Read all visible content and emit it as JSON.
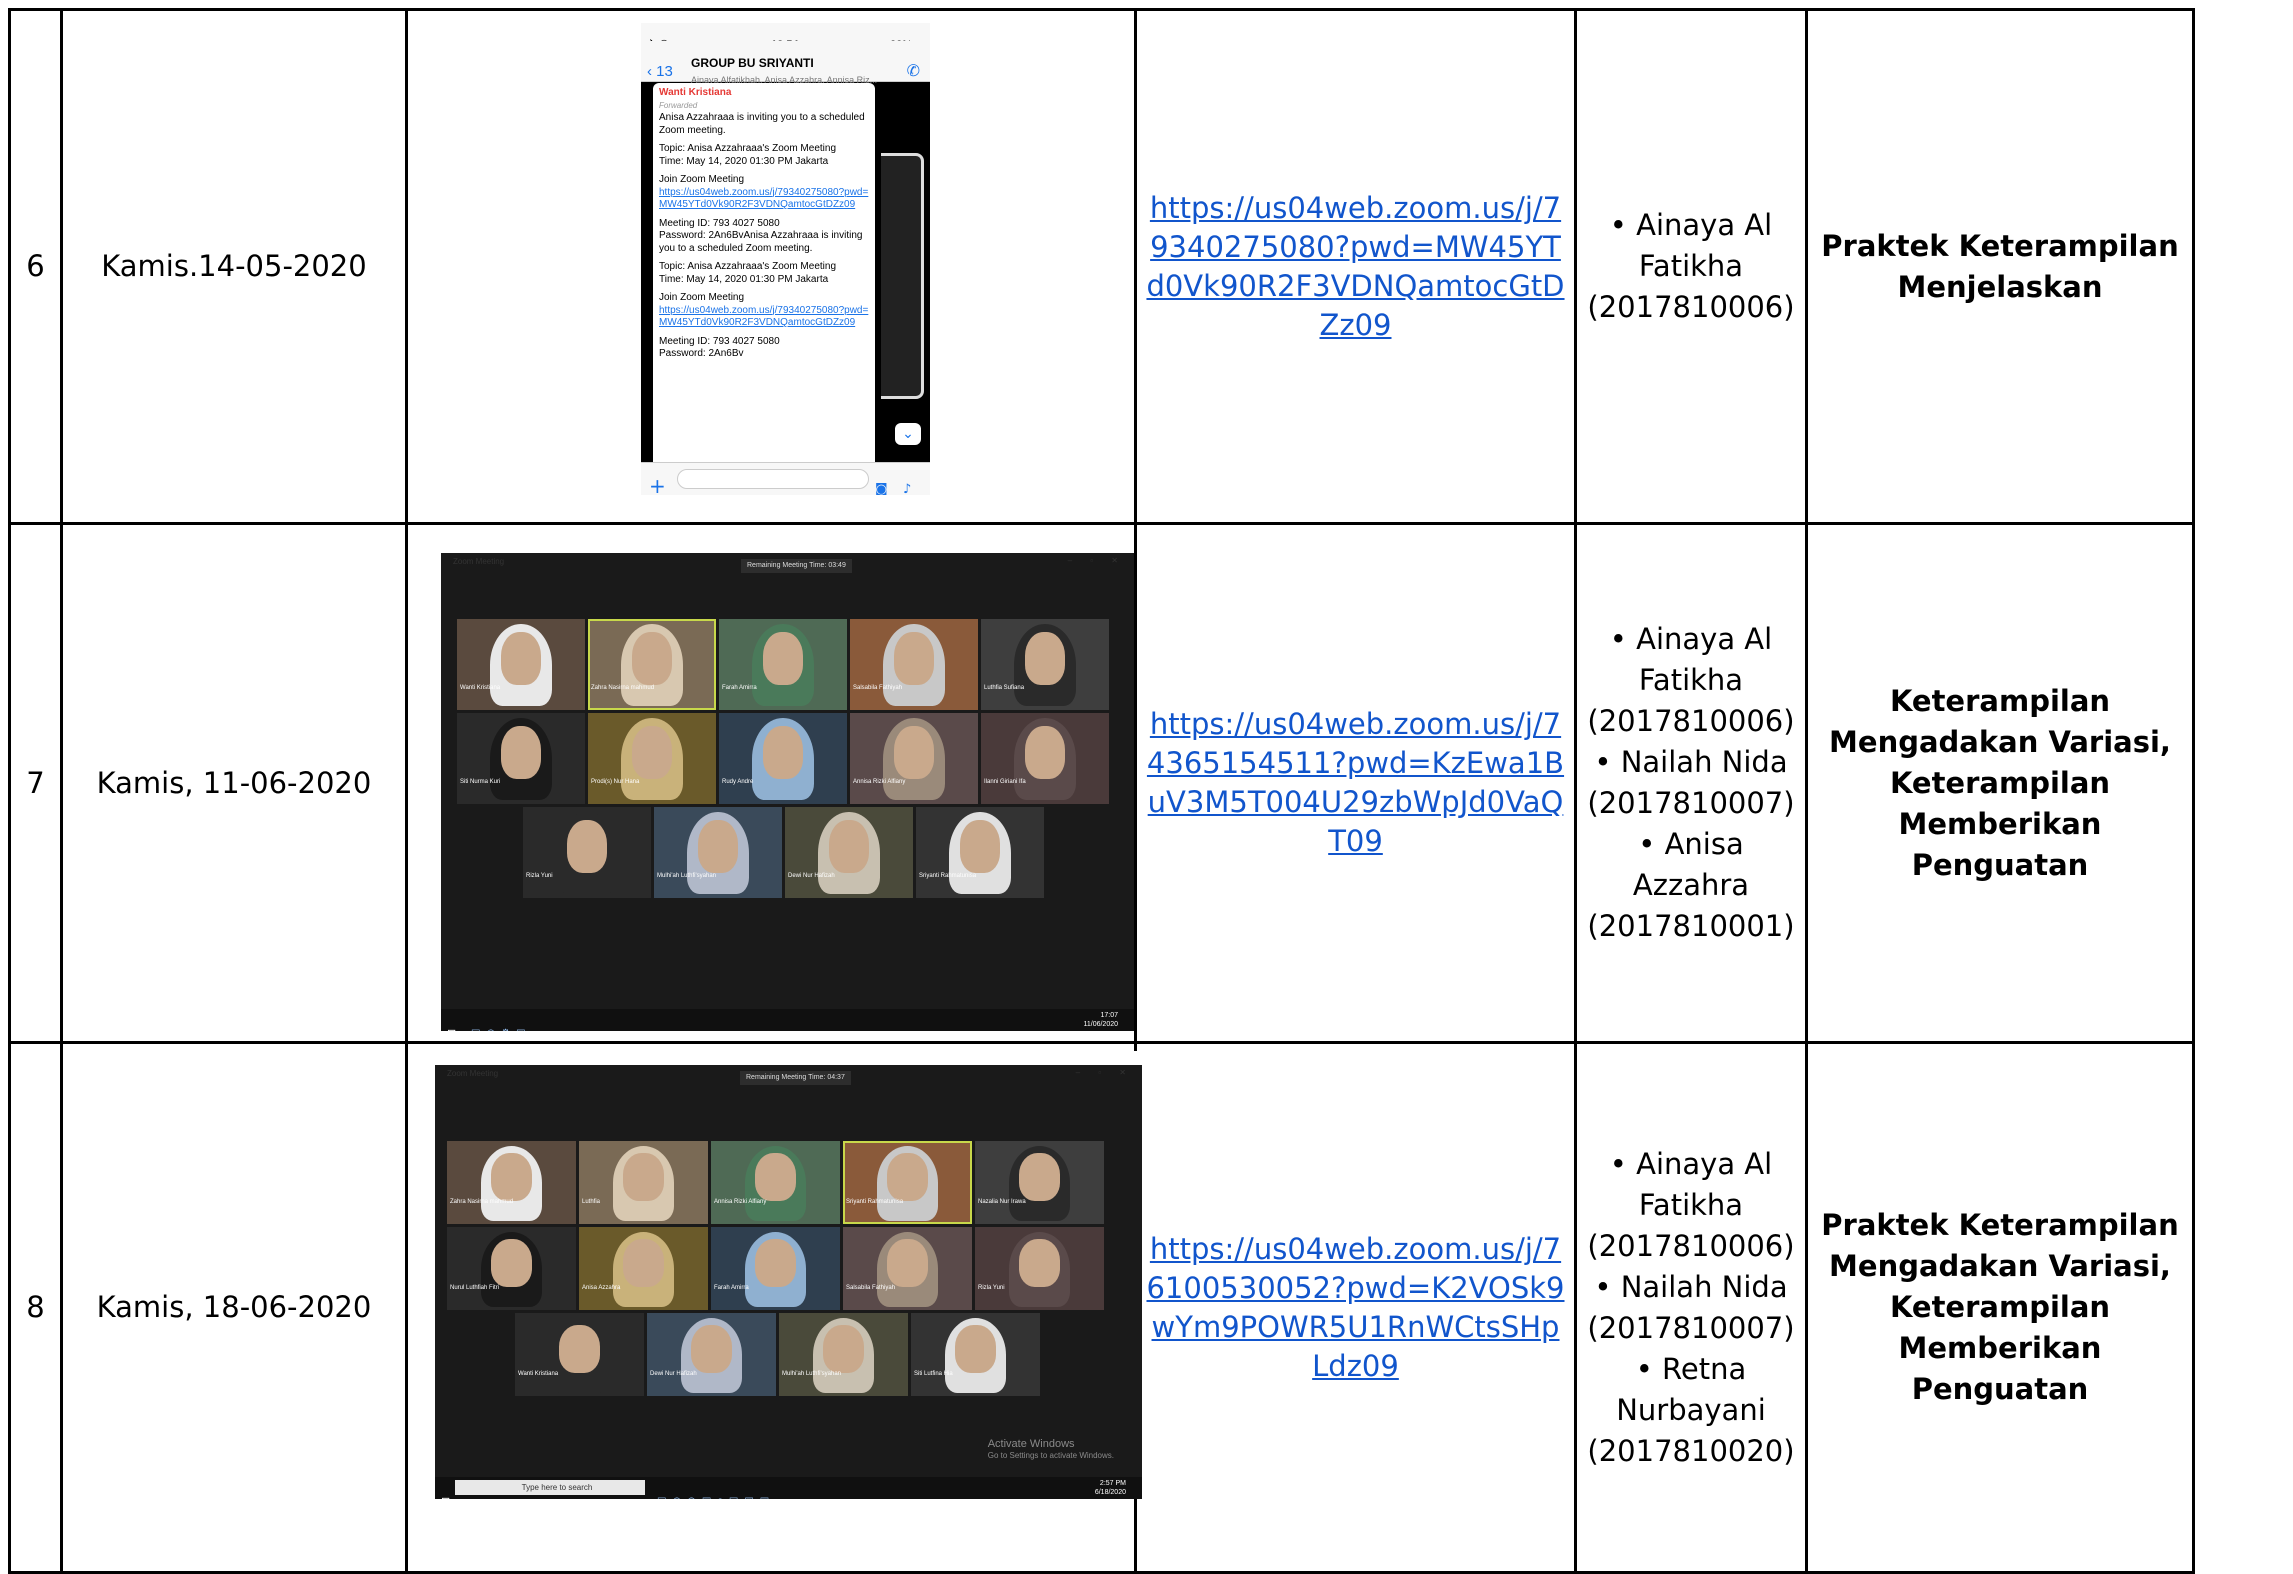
{
  "rows": [
    {
      "no": "6",
      "date": "Kamis.14-05-2020",
      "link": "https://us04web.zoom.us/j/79340275080?pwd=MW45YTd0Vk90R2F3VDNQamtocGtDZz09",
      "names": [
        "• Ainaya Al Fatikha (2017810006)"
      ],
      "topic": "Praktek Keterampilan Menjelaskan"
    },
    {
      "no": "7",
      "date": "Kamis, 11-06-2020",
      "link": "https://us04web.zoom.us/j/74365154511?pwd=KzEwa1BuV3M5T004U29zbWpJd0VaQT09",
      "names": [
        "• Ainaya Al Fatikha (2017810006)",
        "• Nailah Nida (2017810007)",
        "• Anisa Azzahra (2017810001)"
      ],
      "topic": "Keterampilan Mengadakan Variasi, Keterampilan Memberikan Penguatan"
    },
    {
      "no": "8",
      "date": "Kamis, 18-06-2020",
      "link": "https://us04web.zoom.us/j/76100530052?pwd=K2VOSk9wYm9POWR5U1RnWCtsSHpLdz09",
      "names": [
        "• Ainaya Al Fatikha (2017810006)",
        "• Nailah Nida (2017810007)",
        "• Retna Nurbayani (2017810020)"
      ],
      "topic": "Praktek Keterampilan Mengadakan Variasi, Keterampilan Memberikan Penguatan"
    }
  ],
  "phone": {
    "status_time": "12.54",
    "status_battery": "22%",
    "back_label": "13",
    "group_title": "GROUP BU SRIYANTI",
    "group_members": "Ainaya Alfatikhah, Anisa Azzahra, Annisa Riz...",
    "sender": "Wanti Kristiana",
    "forwarded": "Forwarded",
    "paragraphs": [
      "Anisa Azzahraaa is inviting you to a scheduled Zoom meeting.",
      "Topic: Anisa Azzahraaa's Zoom Meeting\nTime: May 14, 2020 01:30 PM Jakarta",
      "Join Zoom Meeting",
      "Meeting ID: 793 4027 5080\nPassword: 2An6BvAnisa Azzahraaa is inviting you to a scheduled Zoom meeting.",
      "Topic: Anisa Azzahraaa's Zoom Meeting\nTime: May 14, 2020 01:30 PM Jakarta",
      "Join Zoom Meeting",
      "Meeting ID: 793 4027 5080\nPassword: 2An6Bv"
    ],
    "chat_link": "https://us04web.zoom.us/j/79340275080?pwd=MW45YTd0Vk90R2F3VDNQamtocGtDZz09"
  },
  "zoom7": {
    "window_title": "Zoom Meeting",
    "timer": "Remaining Meeting Time: 03:49",
    "clock": "17:07\n11/06/2020",
    "participants": [
      "Wanti Kristiana",
      "Zahra Nasirna mahmud",
      "Farah Amirra",
      "Salsabila Fathiyah",
      "Luthfia Sufiana",
      "Siti Nurma Kuri",
      "Prodi(s) Nur Hana",
      "Rudy Andre",
      "Annisa Rizki Alfiany",
      "Ilanni Giriani Ifa",
      "Rizla Yuni",
      "Mulhi'ah Luthfi'syahan",
      "Dewi Nur Hafizah",
      "Sriyanti Rahmatunisa"
    ]
  },
  "zoom8": {
    "window_title": "Zoom Meeting",
    "timer": "Remaining Meeting Time: 04:37",
    "clock": "2:57 PM\n6/18/2020",
    "search_placeholder": "Type here to search",
    "watermark_title": "Activate Windows",
    "watermark_sub": "Go to Settings to activate Windows.",
    "participants": [
      "Zahra Nasirna mahmud",
      "Luthfia",
      "Annisa Rizki Alfiany",
      "Sriyanti Rahmatunisa",
      "Nazalia Nur Irawa",
      "Nurul Luthfiah Fitri",
      "Anisa Azzahra",
      "Farah Amirra",
      "Salsabila Fathiyah",
      "Rizla Yuni",
      "Wanti Kristiana",
      "Dewi Nur Hafizah",
      "Mulhi'ah Luthfi'syahan",
      "Siti Lutfina Hia"
    ]
  },
  "colors": {
    "link": "#1155cc",
    "border": "#000000",
    "zoom_bg": "#1a1a1a",
    "active_speaker": "#c8d84a"
  }
}
